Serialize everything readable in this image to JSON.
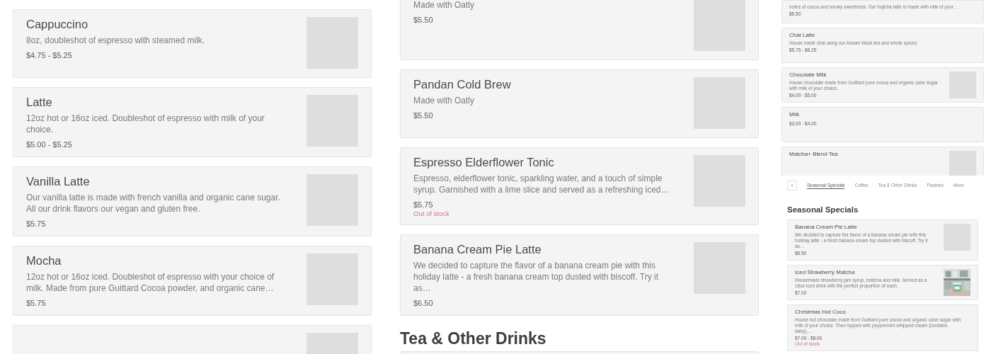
{
  "columns": [
    {
      "blocks": [
        {
          "kind": "image_card",
          "name": "Cappuccino",
          "description": "8oz, doubleshot of espresso with steamed milk.",
          "price": "$4.75 - $5.25"
        },
        {
          "kind": "image_card",
          "name": "Latte",
          "description": "12oz hot or 16oz iced. Doubleshot of espresso with milk of your choice.",
          "price": "$5.00 - $5.25"
        },
        {
          "kind": "image_card",
          "name": "Vanilla Latte",
          "description": "Our vanilla latte is made with french vanilla and organic cane sugar. All our drink flavors our vegan and gluten free.",
          "price": "$5.75"
        },
        {
          "kind": "image_card",
          "name": "Mocha",
          "description": "12oz hot or 16oz iced. Doubleshot of espresso with your choice of milk. Made from pure Guittard Cocoa powder, and organic cane…",
          "price": "$5.75"
        },
        {
          "kind": "image_card"
        }
      ]
    },
    {
      "blocks": [
        {
          "kind": "image_card",
          "description": "Made with Oatly",
          "price": "$5.50"
        },
        {
          "kind": "image_card",
          "name": "Pandan Cold Brew",
          "description": "Made with Oatly",
          "price": "$5.50"
        },
        {
          "kind": "image_card",
          "name": "Espresso Elderflower Tonic",
          "description": "Espresso, elderflower tonic, sparkling water, and a touch of simple syrup. Garnished with a lime slice and served as a refreshing iced…",
          "price": "$5.75",
          "stock_note": "Out of stock"
        },
        {
          "kind": "image_card",
          "name": "Banana Cream Pie Latte",
          "description": "We decided to capture the flavor of a banana cream pie with this holiday latte - a fresh banana cream top dusted with biscoff. Try it as…",
          "price": "$6.50"
        },
        {
          "kind": "heading",
          "text": "Tea & Other Drinks"
        },
        {
          "kind": "card"
        }
      ]
    },
    {
      "blocks": [
        {
          "kind": "card",
          "description": "notes of cocoa and smoky sweetness. Our hojicha latte is made with milk of your…",
          "price": "$5.50"
        },
        {
          "kind": "card",
          "name": "Chai Latte",
          "description": "House made chai using our Assam black tea and whole spices.",
          "price": "$5.75 - $6.25"
        },
        {
          "kind": "image_card",
          "name": "Chocolate Milk",
          "description": "House chocolate made from Guittard pure cocoa and organic cane sugar with milk of your choice.",
          "price": "$4.00 - $5.00"
        },
        {
          "kind": "card",
          "name": "Milk",
          "price": "$3.00 - $4.00"
        },
        {
          "kind": "image_card",
          "name": "Matcha+ Blend Tea"
        },
        {
          "kind": "nav",
          "tabs": [
            {
              "label": "Seasonal Specials",
              "selected": true
            },
            {
              "label": "Coffee",
              "selected": false
            },
            {
              "label": "Tea & Other Drinks",
              "selected": false
            },
            {
              "label": "Pastries",
              "selected": false
            },
            {
              "label": "More",
              "selected": false
            }
          ]
        },
        {
          "kind": "heading",
          "text": "Seasonal Specials"
        },
        {
          "kind": "image_card",
          "name": "Banana Cream Pie Latte",
          "description": "We decided to capture the flavor of a banana cream pie with this holiday latte - a fresh banana cream top dusted with biscoff. Try it as…",
          "price": "$6.50"
        },
        {
          "kind": "photo_card",
          "name": "Iced Strawberry Matcha",
          "description": "Housemade strawberry jam syrup, matcha and milk. Served as a 16oz iced drink with the perfect proportion of each.",
          "price": "$7.00"
        },
        {
          "kind": "card",
          "name": "Christmas Hot Coco",
          "description": "House hot chocolate made from Guittard pure cocoa and organic cane sugar with milk of your choice. Then topped with peppermint whipped cream (contains dairy),…",
          "price": "$7.00 - $8.00",
          "stock_note": "Out of stock"
        }
      ]
    }
  ]
}
